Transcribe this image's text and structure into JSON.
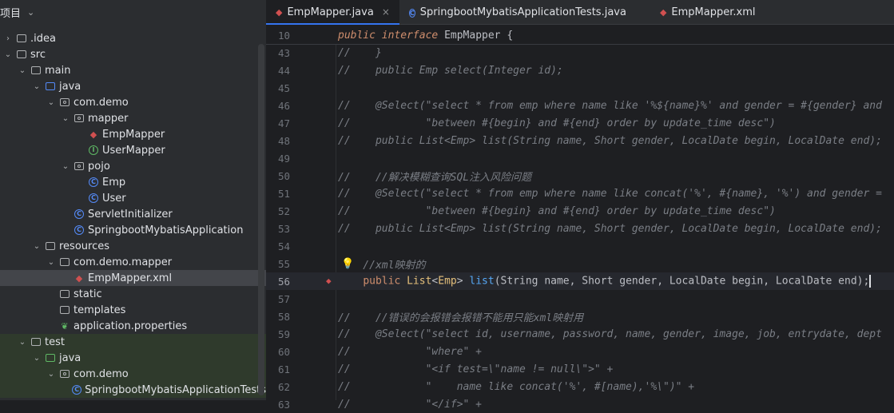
{
  "project": {
    "title": "项目"
  },
  "tree": [
    {
      "label": ".idea",
      "icon": "folder-icon",
      "depth": 0,
      "arrow": "›"
    },
    {
      "label": "src",
      "icon": "folder-icon",
      "depth": 0,
      "arrow": "⌄"
    },
    {
      "label": "main",
      "icon": "folder-icon",
      "depth": 1,
      "arrow": "⌄"
    },
    {
      "label": "java",
      "icon": "source-folder-icon",
      "depth": 2,
      "arrow": "⌄"
    },
    {
      "label": "com.demo",
      "icon": "package-icon",
      "depth": 3,
      "arrow": "⌄"
    },
    {
      "label": "mapper",
      "icon": "package-icon",
      "depth": 4,
      "arrow": "⌄"
    },
    {
      "label": "EmpMapper",
      "icon": "mybatis-icon",
      "depth": 5,
      "arrow": ""
    },
    {
      "label": "UserMapper",
      "icon": "interface-icon",
      "depth": 5,
      "arrow": ""
    },
    {
      "label": "pojo",
      "icon": "package-icon",
      "depth": 4,
      "arrow": "⌄"
    },
    {
      "label": "Emp",
      "icon": "class-icon",
      "depth": 5,
      "arrow": ""
    },
    {
      "label": "User",
      "icon": "class-icon",
      "depth": 5,
      "arrow": ""
    },
    {
      "label": "ServletInitializer",
      "icon": "class-icon",
      "depth": 4,
      "arrow": ""
    },
    {
      "label": "SpringbootMybatisApplication",
      "icon": "spring-class-icon",
      "depth": 4,
      "arrow": ""
    },
    {
      "label": "resources",
      "icon": "resources-folder-icon",
      "depth": 2,
      "arrow": "⌄"
    },
    {
      "label": "com.demo.mapper",
      "icon": "folder-icon",
      "depth": 3,
      "arrow": "⌄"
    },
    {
      "label": "EmpMapper.xml",
      "icon": "mybatis-xml-icon",
      "depth": 4,
      "arrow": ""
    },
    {
      "label": "static",
      "icon": "folder-icon",
      "depth": 3,
      "arrow": ""
    },
    {
      "label": "templates",
      "icon": "folder-icon",
      "depth": 3,
      "arrow": ""
    },
    {
      "label": "application.properties",
      "icon": "properties-icon",
      "depth": 3,
      "arrow": ""
    },
    {
      "label": "test",
      "icon": "folder-icon",
      "depth": 1,
      "arrow": "⌄"
    },
    {
      "label": "java",
      "icon": "test-folder-icon",
      "depth": 2,
      "arrow": "⌄"
    },
    {
      "label": "com.demo",
      "icon": "package-icon",
      "depth": 3,
      "arrow": "⌄"
    },
    {
      "label": "SpringbootMybatisApplicationTests",
      "icon": "spring-class-icon",
      "depth": 4,
      "arrow": ""
    }
  ],
  "tabs": [
    {
      "label": "EmpMapper.java",
      "icon": "mybatis-icon",
      "active": true,
      "close": "×"
    },
    {
      "label": "SpringbootMybatisApplicationTests.java",
      "icon": "class-icon",
      "active": false,
      "close": ""
    },
    {
      "label": "EmpMapper.xml",
      "icon": "mybatis-xml-icon",
      "active": false,
      "close": ""
    }
  ],
  "sticky": {
    "num": "10",
    "text": "public interface EmpMapper {"
  },
  "lines": [
    {
      "num": "43",
      "text": "//    }"
    },
    {
      "num": "44",
      "text": "//    public Emp select(Integer id);"
    },
    {
      "num": "45",
      "text": ""
    },
    {
      "num": "46",
      "text": "//    @Select(\"select * from emp where name like '%${name}%' and gender = #{gender} and"
    },
    {
      "num": "47",
      "text": "//            \"between #{begin} and #{end} order by update_time desc\")"
    },
    {
      "num": "48",
      "text": "//    public List<Emp> list(String name, Short gender, LocalDate begin, LocalDate end);"
    },
    {
      "num": "49",
      "text": ""
    },
    {
      "num": "50",
      "text": "//    //解决模糊查询SQL注入风险问题"
    },
    {
      "num": "51",
      "text": "//    @Select(\"select * from emp where name like concat('%', #{name}, '%') and gender ="
    },
    {
      "num": "52",
      "text": "//            \"between #{begin} and #{end} order by update_time desc\")"
    },
    {
      "num": "53",
      "text": "//    public List<Emp> list(String name, Short gender, LocalDate begin, LocalDate end);"
    },
    {
      "num": "54",
      "text": ""
    },
    {
      "num": "55",
      "text": "    //xml映射的"
    },
    {
      "num": "56",
      "text": "    public List<Emp> list(String name, Short gender, LocalDate begin, LocalDate end);"
    },
    {
      "num": "57",
      "text": ""
    },
    {
      "num": "58",
      "text": "//    //错误的会报错会报错不能用只能xml映射用"
    },
    {
      "num": "59",
      "text": "//    @Select(\"select id, username, password, name, gender, image, job, entrydate, dept"
    },
    {
      "num": "60",
      "text": "//            \"where\" +"
    },
    {
      "num": "61",
      "text": "//            \"<if test=\\\"name != null\\\">\" +"
    },
    {
      "num": "62",
      "text": "//            \"    name like concat('%', #[name),'%\\\")\" +"
    },
    {
      "num": "63",
      "text": "//            \"</if>\" +"
    }
  ]
}
